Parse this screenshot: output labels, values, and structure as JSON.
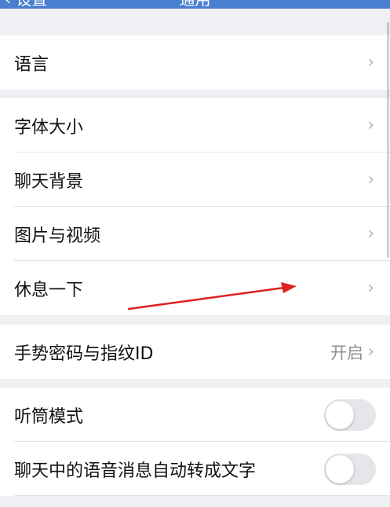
{
  "navbar": {
    "back_label": "‹ 设置",
    "title": "通用",
    "color": "#4a7ed0"
  },
  "groups": [
    {
      "items": [
        {
          "label": "语言",
          "accessory": "chevron"
        }
      ]
    },
    {
      "items": [
        {
          "label": "字体大小",
          "accessory": "chevron"
        },
        {
          "label": "聊天背景",
          "accessory": "chevron"
        },
        {
          "label": "图片与视频",
          "accessory": "chevron"
        },
        {
          "label": "休息一下",
          "accessory": "chevron"
        }
      ]
    },
    {
      "items": [
        {
          "label": "手势密码与指纹ID",
          "value": "开启",
          "accessory": "chevron"
        }
      ]
    },
    {
      "items": [
        {
          "label": "听筒模式",
          "accessory": "toggle",
          "on": false
        },
        {
          "label": "聊天中的语音消息自动转成文字",
          "accessory": "toggle",
          "on": false
        }
      ]
    }
  ],
  "icons": {
    "chevron": "chevron-right-icon",
    "chevron_glyph": "›"
  },
  "annotation": {
    "color": "#e02020"
  }
}
